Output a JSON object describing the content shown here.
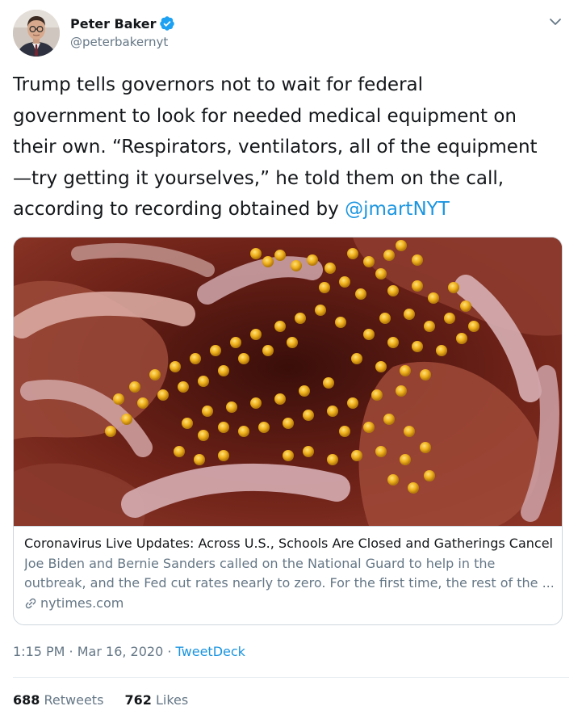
{
  "author": {
    "display_name": "Peter Baker",
    "handle": "@peterbakernyt",
    "verified": true
  },
  "tweet": {
    "text_lines": [
      "Trump tells governors not to wait for federal",
      "government to look for needed medical equipment on",
      "their own. “Respirators, ventilators, all of the equipment",
      "—try getting it yourselves,” he told them on the call,",
      "according to recording obtained by "
    ],
    "mention": "@jmartNYT"
  },
  "card": {
    "title": "Coronavirus Live Updates: Across U.S., Schools Are Closed and Gatherings Cancel...",
    "description_lines": [
      "Joe Biden and Bernie Sanders called on the National Guard to help in the",
      "outbreak, and the Fed cut rates nearly to zero. For the first time, the rest of the ..."
    ],
    "domain": "nytimes.com"
  },
  "meta": {
    "time": "1:15 PM",
    "date": "Mar 16, 2020",
    "separator": " · ",
    "source": "TweetDeck"
  },
  "stats": {
    "retweets_count": "688",
    "retweets_label": "Retweets",
    "likes_count": "762",
    "likes_label": "Likes"
  },
  "colors": {
    "link_blue": "#1b95e0",
    "verified_blue": "#1da1f2",
    "secondary_text": "#657786",
    "primary_text": "#14171a",
    "border": "#ccd6dd"
  },
  "icons": {
    "verified": "verified-badge-icon",
    "caret": "chevron-down-icon",
    "link": "link-icon"
  }
}
